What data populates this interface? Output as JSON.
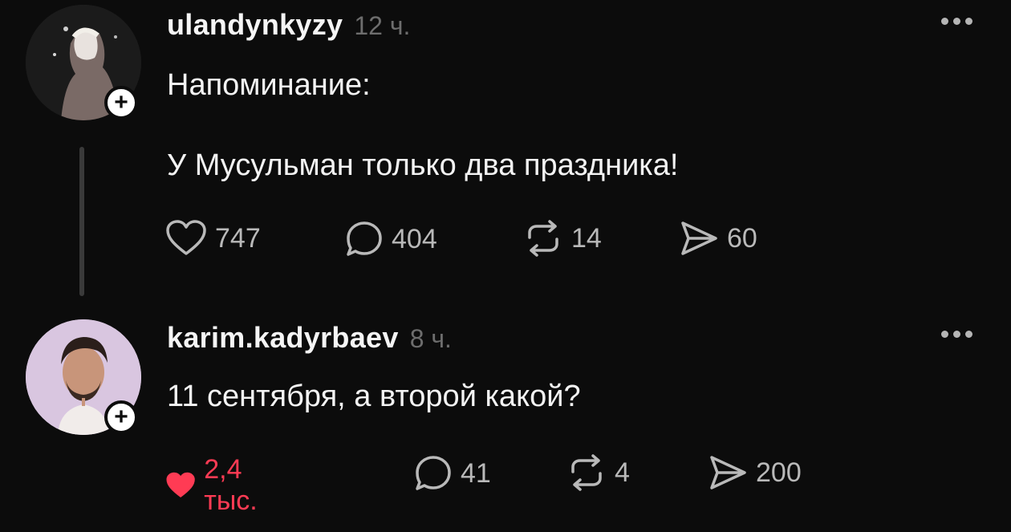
{
  "posts": [
    {
      "username": "ulandynkyzy",
      "time": "12 ч.",
      "lines": [
        "Напоминание:",
        "У Мусульман только два праздника!"
      ],
      "likes": "747",
      "comments": "404",
      "reposts": "14",
      "shares": "60",
      "liked": false
    },
    {
      "username": "karim.kadyrbaev",
      "time": "8 ч.",
      "lines": [
        "11 сентября, а второй какой?"
      ],
      "likes": "2,4 тыс.",
      "comments": "41",
      "reposts": "4",
      "shares": "200",
      "liked": true
    }
  ],
  "icons": {
    "like": "heart-icon",
    "comment": "comment-bubble-icon",
    "repost": "repost-icon",
    "share": "share-icon",
    "more": "more-options-icon",
    "follow": "plus-icon"
  },
  "colors": {
    "background": "#0c0c0c",
    "liked": "#ff3b54",
    "muted": "#6d6d6d"
  }
}
